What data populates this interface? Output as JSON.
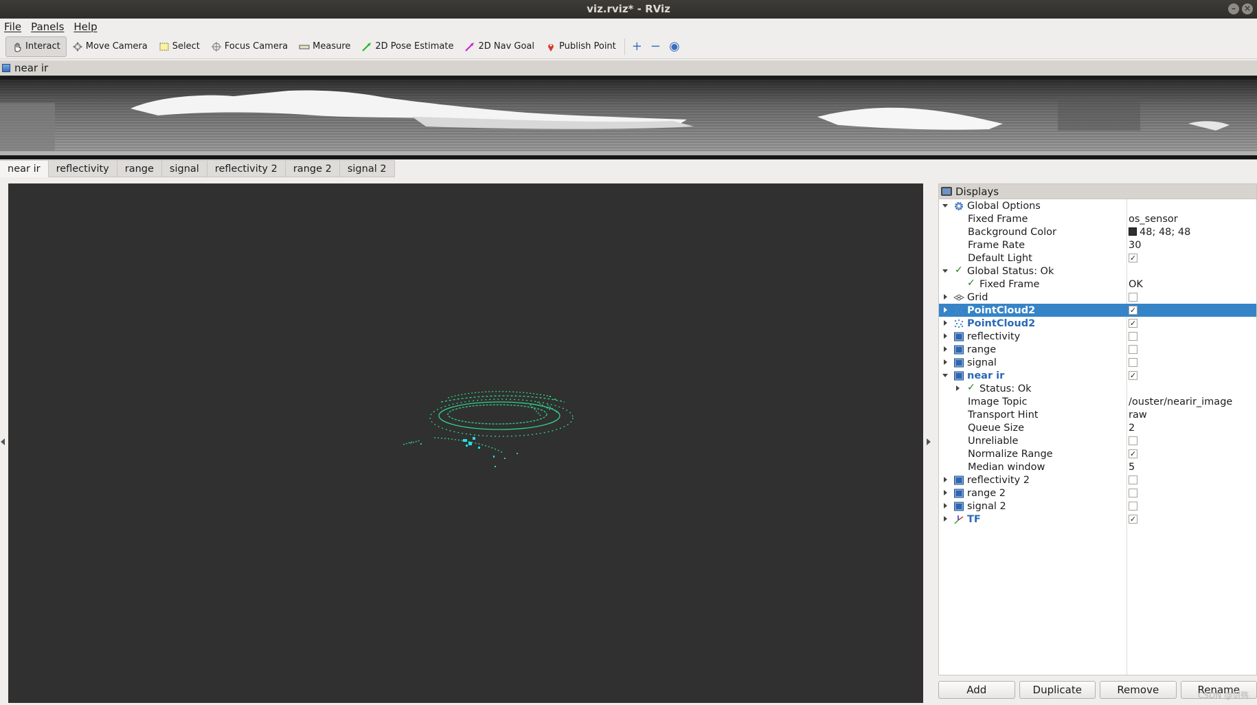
{
  "window": {
    "title": "viz.rviz* - RViz"
  },
  "menu": {
    "items": [
      "File",
      "Panels",
      "Help"
    ]
  },
  "toolbar": {
    "tools": [
      {
        "label": "Interact",
        "icon": "hand-icon",
        "active": true
      },
      {
        "label": "Move Camera",
        "icon": "move-camera-icon"
      },
      {
        "label": "Select",
        "icon": "select-box-icon"
      },
      {
        "label": "Focus Camera",
        "icon": "focus-target-icon"
      },
      {
        "label": "Measure",
        "icon": "ruler-icon"
      },
      {
        "label": "2D Pose Estimate",
        "icon": "green-arrow-icon"
      },
      {
        "label": "2D Nav Goal",
        "icon": "magenta-arrow-icon"
      },
      {
        "label": "Publish Point",
        "icon": "map-pin-icon"
      }
    ],
    "plus": "+",
    "minus": "−",
    "eye": "◉"
  },
  "image_panel": {
    "title": "near ir"
  },
  "tabs": [
    "near ir",
    "reflectivity",
    "range",
    "signal",
    "reflectivity 2",
    "range 2",
    "signal 2"
  ],
  "displays": {
    "title": "Displays",
    "rows": [
      {
        "label": "Global Options",
        "indent": 0,
        "arrow": "open",
        "icon": "gear-icon"
      },
      {
        "label": "Fixed Frame",
        "indent": 1,
        "value": "os_sensor"
      },
      {
        "label": "Background Color",
        "indent": 1,
        "value": "48; 48; 48",
        "swatch": "#303030"
      },
      {
        "label": "Frame Rate",
        "indent": 1,
        "value": "30"
      },
      {
        "label": "Default Light",
        "indent": 1,
        "checked": true
      },
      {
        "label": "Global Status: Ok",
        "indent": 0,
        "arrow": "open",
        "ok": true
      },
      {
        "label": "Fixed Frame",
        "indent": 1,
        "value": "OK",
        "ok": true
      },
      {
        "label": "Grid",
        "indent": 0,
        "arrow": "closed",
        "icon": "grid-icon",
        "checked": false
      },
      {
        "label": "PointCloud2",
        "indent": 0,
        "arrow": "closed",
        "icon": "pointcloud-icon",
        "checked": true,
        "selected": true,
        "blue": true
      },
      {
        "label": "PointCloud2",
        "indent": 0,
        "arrow": "closed",
        "icon": "pointcloud-icon",
        "checked": true,
        "blue": true
      },
      {
        "label": "reflectivity",
        "indent": 0,
        "arrow": "closed",
        "icon": "image-icon",
        "checked": false
      },
      {
        "label": "range",
        "indent": 0,
        "arrow": "closed",
        "icon": "image-icon",
        "checked": false
      },
      {
        "label": "signal",
        "indent": 0,
        "arrow": "closed",
        "icon": "image-icon",
        "checked": false
      },
      {
        "label": "near ir",
        "indent": 0,
        "arrow": "open",
        "icon": "image-icon",
        "checked": true,
        "blue": true
      },
      {
        "label": "Status: Ok",
        "indent": 1,
        "arrow": "closed",
        "ok": true
      },
      {
        "label": "Image Topic",
        "indent": 1,
        "value": "/ouster/nearir_image"
      },
      {
        "label": "Transport Hint",
        "indent": 1,
        "value": "raw"
      },
      {
        "label": "Queue Size",
        "indent": 1,
        "value": "2"
      },
      {
        "label": "Unreliable",
        "indent": 1,
        "checked": false
      },
      {
        "label": "Normalize Range",
        "indent": 1,
        "checked": true
      },
      {
        "label": "Median window",
        "indent": 1,
        "value": "5"
      },
      {
        "label": "reflectivity 2",
        "indent": 0,
        "arrow": "closed",
        "icon": "image-icon",
        "checked": false
      },
      {
        "label": "range 2",
        "indent": 0,
        "arrow": "closed",
        "icon": "image-icon",
        "checked": false
      },
      {
        "label": "signal 2",
        "indent": 0,
        "arrow": "closed",
        "icon": "image-icon",
        "checked": false
      },
      {
        "label": "TF",
        "indent": 0,
        "arrow": "closed",
        "icon": "tf-axes-icon",
        "checked": true,
        "blue": true
      }
    ]
  },
  "buttons": [
    "Add",
    "Duplicate",
    "Remove",
    "Rename"
  ],
  "watermark": "CSDN @剑殇",
  "colors": {
    "selection": "#3584c8",
    "viewport_bg": "#303030",
    "cloud": "#2fd38a",
    "cloud_accent": "#22e0e8"
  }
}
